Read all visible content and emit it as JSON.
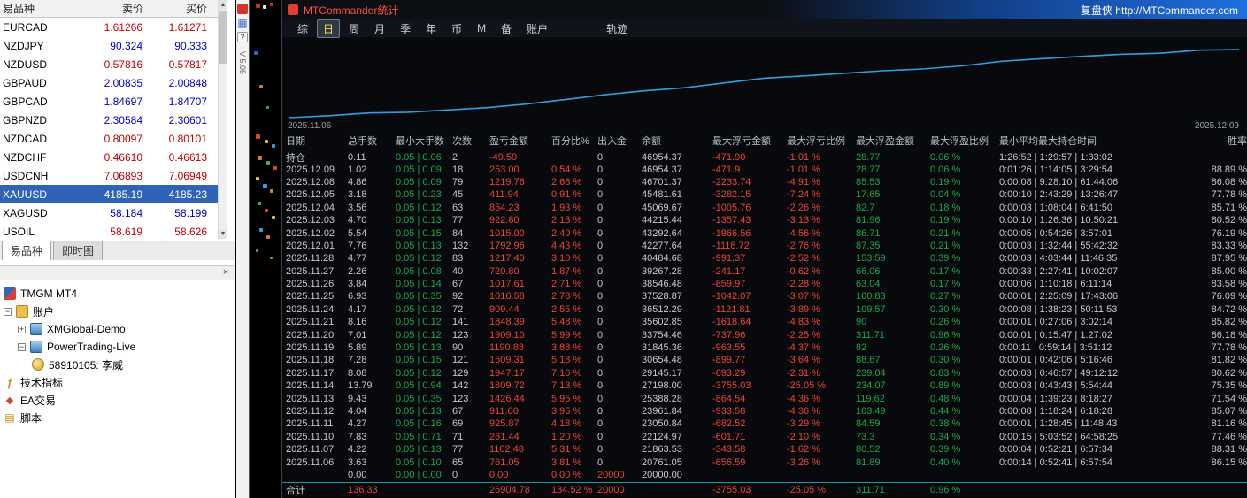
{
  "market_watch": {
    "header": {
      "symbol": "易品种",
      "bid": "卖价",
      "ask": "买价"
    },
    "rows": [
      {
        "symbol": "EURCAD",
        "bid": "1.61266",
        "ask": "1.61271",
        "color": "red",
        "selected": false
      },
      {
        "symbol": "NZDJPY",
        "bid": "90.324",
        "ask": "90.333",
        "color": "blue",
        "selected": false
      },
      {
        "symbol": "NZDUSD",
        "bid": "0.57816",
        "ask": "0.57817",
        "color": "red",
        "selected": false
      },
      {
        "symbol": "GBPAUD",
        "bid": "2.00835",
        "ask": "2.00848",
        "color": "blue",
        "selected": false
      },
      {
        "symbol": "GBPCAD",
        "bid": "1.84697",
        "ask": "1.84707",
        "color": "blue",
        "selected": false
      },
      {
        "symbol": "GBPNZD",
        "bid": "2.30584",
        "ask": "2.30601",
        "color": "blue",
        "selected": false
      },
      {
        "symbol": "NZDCAD",
        "bid": "0.80097",
        "ask": "0.80101",
        "color": "red",
        "selected": false
      },
      {
        "symbol": "NZDCHF",
        "bid": "0.46610",
        "ask": "0.46613",
        "color": "red",
        "selected": false
      },
      {
        "symbol": "USDCNH",
        "bid": "7.06893",
        "ask": "7.06949",
        "color": "red",
        "selected": false
      },
      {
        "symbol": "XAUUSD",
        "bid": "4185.19",
        "ask": "4185.23",
        "color": "white",
        "selected": true
      },
      {
        "symbol": "XAGUSD",
        "bid": "58.184",
        "ask": "58.199",
        "color": "blue",
        "selected": false
      },
      {
        "symbol": "USOIL",
        "bid": "58.619",
        "ask": "58.626",
        "color": "red",
        "selected": false
      }
    ],
    "tabs": [
      {
        "label": "易品种",
        "active": true
      },
      {
        "label": "即时图",
        "active": false
      }
    ]
  },
  "navigator": {
    "close_label": "×",
    "items": [
      {
        "label": "TMGM MT4",
        "level": 0,
        "expander": "",
        "icon": "tmgm-icon"
      },
      {
        "label": "账户",
        "level": 0,
        "expander": "-",
        "icon": "accounts-icon"
      },
      {
        "label": "XMGlobal-Demo",
        "level": 1,
        "expander": "+",
        "icon": "account-icon"
      },
      {
        "label": "PowerTrading-Live",
        "level": 1,
        "expander": "-",
        "icon": "account-icon"
      },
      {
        "label": "58910105: 李威",
        "level": 2,
        "expander": "",
        "icon": "login-icon"
      },
      {
        "label": "技术指标",
        "level": 0,
        "expander": "",
        "icon": "indicator-icon"
      },
      {
        "label": "EA交易",
        "level": 0,
        "expander": "",
        "icon": "ea-icon"
      },
      {
        "label": "脚本",
        "level": 0,
        "expander": "",
        "icon": "script-icon"
      }
    ]
  },
  "side_strip": {
    "version": "V 5.05",
    "help_label": "?"
  },
  "stats_window": {
    "title": "MTCommander统计",
    "brand": "复盘侠 http://MTCommander.com",
    "menu": [
      "综",
      "日",
      "周",
      "月",
      "季",
      "年",
      "币",
      "M",
      "备",
      "账户"
    ],
    "menu_selected": "日",
    "menu_right": "轨迹",
    "table": {
      "headers": [
        "日期",
        "总手数",
        "最小大手数",
        "次数",
        "盈亏金额",
        "百分比%",
        "出入金",
        "余额",
        "最大浮亏金额",
        "最大浮亏比例",
        "最大浮盈金额",
        "最大浮盈比例",
        "最小平均最大持仓时间",
        "胜率"
      ],
      "rows": [
        [
          "持仓",
          "0.11",
          "0.05 | 0.06",
          "2",
          "-49.59",
          "",
          "0",
          "46954.37",
          "-471.90",
          "-1.01 %",
          "28.77",
          "0.06 %",
          "1:26:52 | 1:29:57 | 1:33:02",
          ""
        ],
        [
          "2025.12.09",
          "1.02",
          "0.05 | 0.09",
          "18",
          "253.00",
          "0.54 %",
          "0",
          "46954.37",
          "-471.9",
          "-1.01 %",
          "28.77",
          "0.06 %",
          "0:01:26 | 1:14:05 | 3:29:54",
          "88.89 %"
        ],
        [
          "2025.12.08",
          "4.86",
          "0.05 | 0.09",
          "79",
          "1219.76",
          "2.68 %",
          "0",
          "46701.37",
          "-2233.74",
          "-4.91 %",
          "85.53",
          "0.19 %",
          "0:00:08 | 9:28:10 | 61:44:06",
          "86.08 %"
        ],
        [
          "2025.12.05",
          "3.18",
          "0.05 | 0.23",
          "45",
          "411.94",
          "0.91 %",
          "0",
          "45481.61",
          "-3282.15",
          "-7.24 %",
          "17.65",
          "0.04 %",
          "0:00:10 | 2:43:29 | 13:26:47",
          "77.78 %"
        ],
        [
          "2025.12.04",
          "3.56",
          "0.05 | 0.12",
          "63",
          "854.23",
          "1.93 %",
          "0",
          "45069.67",
          "-1005.76",
          "-2.26 %",
          "82.7",
          "0.18 %",
          "0:00:03 | 1:08:04 | 6:41:50",
          "85.71 %"
        ],
        [
          "2025.12.03",
          "4.70",
          "0.05 | 0.13",
          "77",
          "922.80",
          "2.13 %",
          "0",
          "44215.44",
          "-1357.43",
          "-3.13 %",
          "81.96",
          "0.19 %",
          "0:00:10 | 1:26:36 | 10:50:21",
          "80.52 %"
        ],
        [
          "2025.12.02",
          "5.54",
          "0.05 | 0.15",
          "84",
          "1015.00",
          "2.40 %",
          "0",
          "43292.64",
          "-1966.56",
          "-4.56 %",
          "86.71",
          "0.21 %",
          "0:00:05 | 0:54:26 | 3:57:01",
          "76.19 %"
        ],
        [
          "2025.12.01",
          "7.76",
          "0.05 | 0.13",
          "132",
          "1792.96",
          "4.43 %",
          "0",
          "42277.64",
          "-1118.72",
          "-2.76 %",
          "87.35",
          "0.21 %",
          "0:00:03 | 1:32:44 | 55:42:32",
          "83.33 %"
        ],
        [
          "2025.11.28",
          "4.77",
          "0.05 | 0.12",
          "83",
          "1217.40",
          "3.10 %",
          "0",
          "40484.68",
          "-991.37",
          "-2.52 %",
          "153.59",
          "0.39 %",
          "0:00:03 | 4:03:44 | 11:46:35",
          "87.95 %"
        ],
        [
          "2025.11.27",
          "2.26",
          "0.05 | 0.08",
          "40",
          "720.80",
          "1.87 %",
          "0",
          "39267.28",
          "-241.17",
          "-0.62 %",
          "66.06",
          "0.17 %",
          "0:00:33 | 2:27:41 | 10:02:07",
          "85.00 %"
        ],
        [
          "2025.11.26",
          "3.84",
          "0.05 | 0.14",
          "67",
          "1017.61",
          "2.71 %",
          "0",
          "38546.48",
          "-859.97",
          "-2.28 %",
          "63.04",
          "0.17 %",
          "0:00:06 | 1:10:18 | 6:11:14",
          "83.58 %"
        ],
        [
          "2025.11.25",
          "6.93",
          "0.05 | 0.35",
          "92",
          "1016.58",
          "2.78 %",
          "0",
          "37528.87",
          "-1042.07",
          "-3.07 %",
          "100.83",
          "0.27 %",
          "0:00:01 | 2:25:09 | 17:43:06",
          "76.09 %"
        ],
        [
          "2025.11.24",
          "4.17",
          "0.05 | 0.12",
          "72",
          "909.44",
          "2.55 %",
          "0",
          "36512.29",
          "-1121.81",
          "-3.89 %",
          "109.57",
          "0.30 %",
          "0:00:08 | 1:38:23 | 50:11:53",
          "84.72 %"
        ],
        [
          "2025.11.21",
          "8.16",
          "0.05 | 0.12",
          "141",
          "1848.39",
          "5.48 %",
          "0",
          "35602.85",
          "-1618.64",
          "-4.83 %",
          "90",
          "0.26 %",
          "0:00:01 | 0:27:06 | 3:02:14",
          "85.82 %"
        ],
        [
          "2025.11.20",
          "7.01",
          "0.05 | 0.12",
          "123",
          "1909.10",
          "5.99 %",
          "0",
          "33754.46",
          "-737.96",
          "-2.25 %",
          "311.71",
          "0.96 %",
          "0:00:01 | 0:15:47 | 1:27:02",
          "86.18 %"
        ],
        [
          "2025.11.19",
          "5.89",
          "0.05 | 0.13",
          "90",
          "1190.88",
          "3.88 %",
          "0",
          "31845.36",
          "-963.55",
          "-4.37 %",
          "82",
          "0.26 %",
          "0:00:11 | 0:59:14 | 3:51:12",
          "77.78 %"
        ],
        [
          "2025.11.18",
          "7.28",
          "0.05 | 0.15",
          "121",
          "1509.31",
          "5.18 %",
          "0",
          "30654.48",
          "-899.77",
          "-3.64 %",
          "88.67",
          "0.30 %",
          "0:00:01 | 0:42:06 | 5:16:46",
          "81.82 %"
        ],
        [
          "2025.11.17",
          "8.08",
          "0.05 | 0.12",
          "129",
          "1947.17",
          "7.16 %",
          "0",
          "29145.17",
          "-693.29",
          "-2.31 %",
          "239.04",
          "0.83 %",
          "0:00:03 | 0:46:57 | 49:12:12",
          "80.62 %"
        ],
        [
          "2025.11.14",
          "13.79",
          "0.05 | 0.94",
          "142",
          "1809.72",
          "7.13 %",
          "0",
          "27198.00",
          "-3755.03",
          "-25.05 %",
          "234.07",
          "0.89 %",
          "0:00:03 | 0:43:43 | 5:54:44",
          "75.35 %"
        ],
        [
          "2025.11.13",
          "9.43",
          "0.05 | 0.35",
          "123",
          "1426.44",
          "5.95 %",
          "0",
          "25388.28",
          "-864.54",
          "-4.36 %",
          "119.62",
          "0.48 %",
          "0:00:04 | 1:39:23 | 8:18:27",
          "71.54 %"
        ],
        [
          "2025.11.12",
          "4.04",
          "0.05 | 0.13",
          "67",
          "911.00",
          "3.95 %",
          "0",
          "23961.84",
          "-933.58",
          "-4.36 %",
          "103.49",
          "0.44 %",
          "0:00:08 | 1:18:24 | 6:18:28",
          "85.07 %"
        ],
        [
          "2025.11.11",
          "4.27",
          "0.05 | 0.16",
          "69",
          "925.87",
          "4.18 %",
          "0",
          "23050.84",
          "-682.52",
          "-3.29 %",
          "84.59",
          "0.38 %",
          "0:00:01 | 1:28:45 | 11:48:43",
          "81.16 %"
        ],
        [
          "2025.11.10",
          "7.83",
          "0.05 | 0.71",
          "71",
          "261.44",
          "1.20 %",
          "0",
          "22124.97",
          "-601.71",
          "-2.10 %",
          "73.3",
          "0.34 %",
          "0:00:15 | 5:03:52 | 64:58:25",
          "77.46 %"
        ],
        [
          "2025.11.07",
          "4.22",
          "0.05 | 0.13",
          "77",
          "1102.48",
          "5.31 %",
          "0",
          "21863.53",
          "-343.58",
          "-1.62 %",
          "80.52",
          "0.39 %",
          "0:00:04 | 0:52:21 | 6:57:34",
          "88.31 %"
        ],
        [
          "2025.11.06",
          "3.63",
          "0.05 | 0.10",
          "65",
          "761.05",
          "3.81 %",
          "0",
          "20761.05",
          "-656.59",
          "-3.26 %",
          "81.89",
          "0.40 %",
          "0:00:14 | 0:52:41 | 6:57:54",
          "86.15 %"
        ],
        [
          "",
          "0.00",
          "0.00 | 0.00",
          "0",
          "0.00",
          "0.00 %",
          "20000",
          "20000.00",
          "",
          "",
          "",
          "",
          "",
          ""
        ]
      ],
      "total": [
        "合计",
        "136.33",
        "",
        "",
        "26904.78",
        "134.52 %",
        "20000",
        "",
        "-3755.03",
        "-25.05 %",
        "311.71",
        "0.96 %",
        "",
        ""
      ]
    }
  },
  "chart_data": {
    "type": "line",
    "title": "账户余额曲线 (equity curve)",
    "x_visible_labels": {
      "start": "2025.11.06",
      "end": "2025.12.09"
    },
    "start_value": 20000,
    "x": [
      "2025.11.06",
      "2025.11.07",
      "2025.11.10",
      "2025.11.11",
      "2025.11.12",
      "2025.11.13",
      "2025.11.14",
      "2025.11.17",
      "2025.11.18",
      "2025.11.19",
      "2025.11.20",
      "2025.11.21",
      "2025.11.24",
      "2025.11.25",
      "2025.11.26",
      "2025.11.27",
      "2025.11.28",
      "2025.12.01",
      "2025.12.02",
      "2025.12.03",
      "2025.12.04",
      "2025.12.05",
      "2025.12.08",
      "2025.12.09"
    ],
    "series": [
      {
        "name": "余额",
        "values": [
          20761.05,
          21863.53,
          22124.97,
          23050.84,
          23961.84,
          25388.28,
          27198.0,
          29145.17,
          30654.48,
          31845.36,
          33754.46,
          35602.85,
          36512.29,
          37528.87,
          38546.48,
          39267.28,
          40484.68,
          42277.64,
          43292.64,
          44215.44,
          45069.67,
          45481.61,
          46701.37,
          46954.37
        ]
      }
    ],
    "ylim": [
      20000,
      48000
    ],
    "line_color": "#2f9fe3",
    "grid": false,
    "legend": false
  }
}
